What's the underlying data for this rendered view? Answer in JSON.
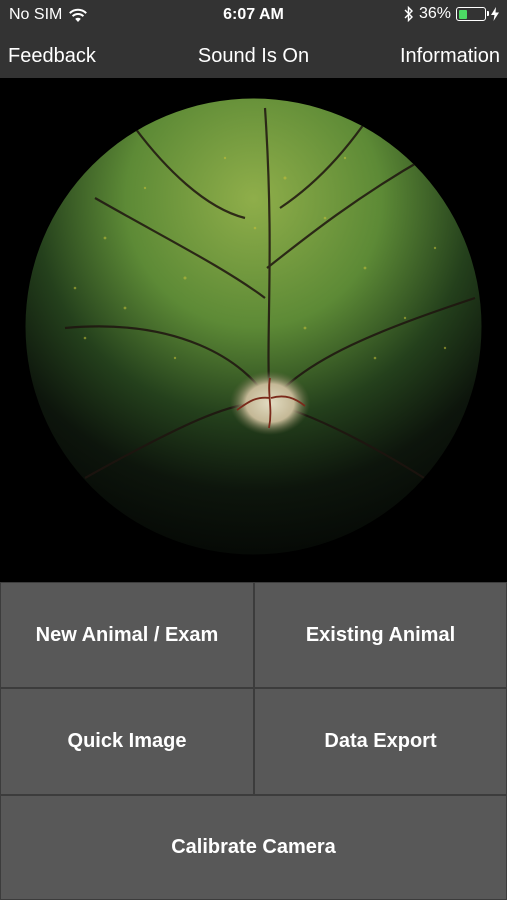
{
  "status_bar": {
    "carrier": "No SIM",
    "time": "6:07 AM",
    "battery_percent": "36%",
    "battery_level": 0.36,
    "icons": [
      "wifi-icon",
      "bluetooth-icon",
      "battery-icon",
      "charging-bolt-icon"
    ]
  },
  "nav": {
    "left_label": "Feedback",
    "center_label": "Sound Is On",
    "right_label": "Information"
  },
  "image": {
    "description_icon": "retina-fundus-image"
  },
  "buttons": {
    "new_animal": "New Animal / Exam",
    "existing_animal": "Existing Animal",
    "quick_image": "Quick Image",
    "data_export": "Data Export",
    "calibrate_camera": "Calibrate Camera"
  },
  "colors": {
    "bar_background": "#333333",
    "button_background": "#585858",
    "button_border": "#3c3c3c",
    "battery_fill": "#4cd964"
  }
}
